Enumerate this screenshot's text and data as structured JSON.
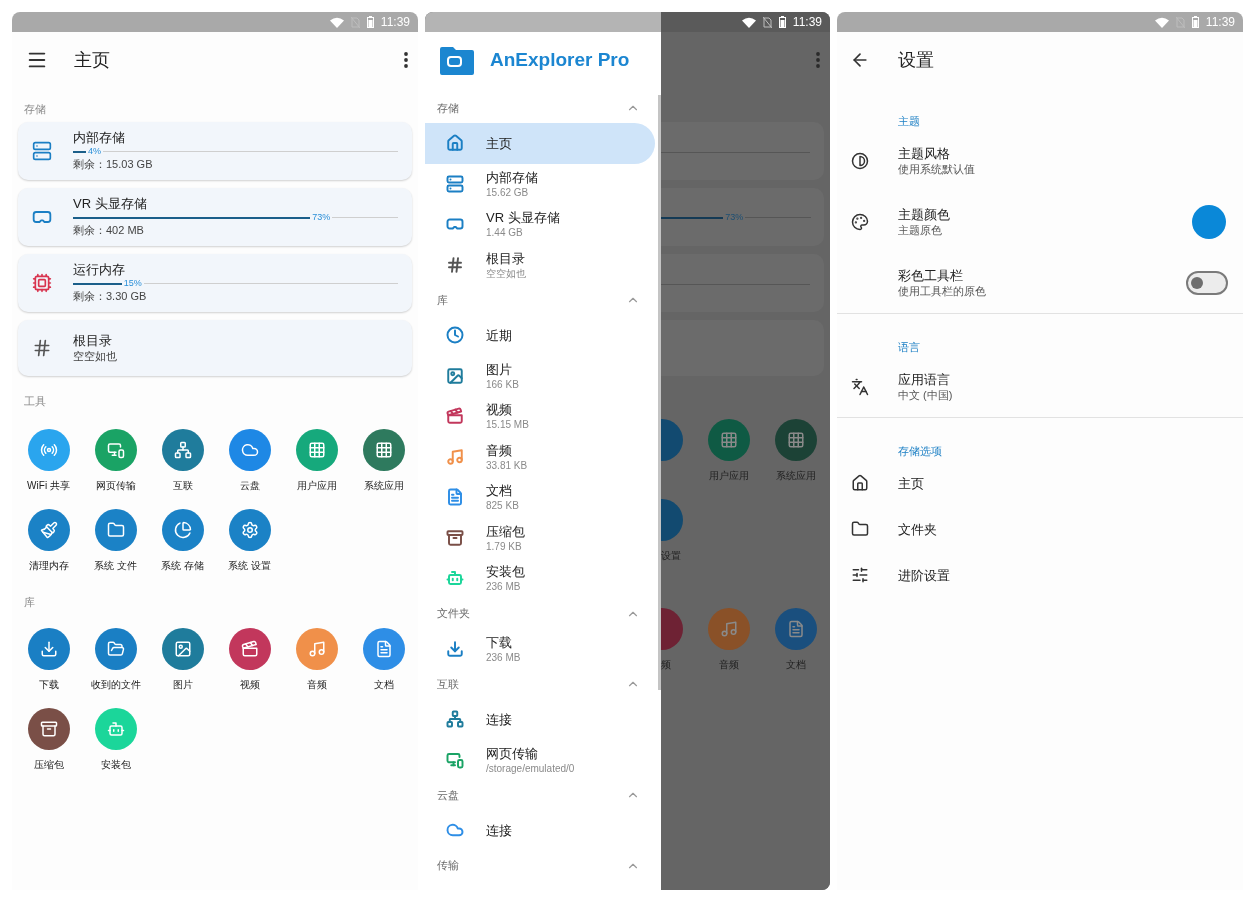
{
  "home": {
    "time": "11:39",
    "title": "主页",
    "storage_title": "存储",
    "storage": [
      {
        "kind": "meter",
        "name": "内部存储",
        "level": 0.04,
        "reading": "4%",
        "subtitle": "剩余：15.03 GB",
        "color": "#1b7fc4"
      },
      {
        "kind": "meter",
        "name": "VR 头显存储",
        "level": 0.73,
        "reading": "73%",
        "subtitle": "剩余：402 MB",
        "color": "#1b7fc4"
      },
      {
        "kind": "meter",
        "name": "运行内存",
        "level": 0.15,
        "reading": "15%",
        "subtitle": "剩余：3.30 GB",
        "color": "#d8344f"
      },
      {
        "kind": "plain",
        "name": "根目录",
        "subtitle": "空空如也",
        "color": "#555555"
      }
    ],
    "tools_title": "工具",
    "tools": [
      {
        "label": "WiFi 共享",
        "color": "#2aa5ee"
      },
      {
        "label": "网页传输",
        "color": "#1aa365"
      },
      {
        "label": "互联",
        "color": "#1f7c9c"
      },
      {
        "label": "云盘",
        "color": "#1e88e5"
      },
      {
        "label": "用户应用",
        "color": "#16a97c"
      },
      {
        "label": "系统应用",
        "color": "#2e7a5e"
      },
      {
        "label": "清理内存",
        "color": "#1b82c6"
      },
      {
        "label": "系统 文件",
        "color": "#1b82c6"
      },
      {
        "label": "系统 存储",
        "color": "#1b82c6"
      },
      {
        "label": "系统 设置",
        "color": "#1b82c6"
      }
    ],
    "library_title": "库",
    "library": [
      {
        "label": "下载",
        "color": "#1a7fc4"
      },
      {
        "label": "收到的文件",
        "color": "#1a7fc4"
      },
      {
        "label": "图片",
        "color": "#1f7c9c"
      },
      {
        "label": "视频",
        "color": "#c2375c"
      },
      {
        "label": "音频",
        "color": "#f0904a"
      },
      {
        "label": "文档",
        "color": "#2e8ee6"
      },
      {
        "label": "压缩包",
        "color": "#7a4f47"
      },
      {
        "label": "安装包",
        "color": "#1bd69a"
      }
    ]
  },
  "drawer": {
    "time": "11:39",
    "app_name": "AnExplorer Pro",
    "sections": [
      {
        "title": "存储",
        "expanded": true,
        "items": [
          {
            "label": "主页",
            "selected": true,
            "color": "#1b7fc4"
          },
          {
            "label": "内部存储",
            "subtitle": "15.62 GB",
            "selected": false,
            "color": "#1b7fc4"
          },
          {
            "label": "VR 头显存储",
            "subtitle": "1.44 GB",
            "selected": false,
            "color": "#1b7fc4"
          },
          {
            "label": "根目录",
            "subtitle": "空空如也",
            "selected": false,
            "color": "#555555"
          }
        ]
      },
      {
        "title": "库",
        "expanded": true,
        "items": [
          {
            "label": "近期",
            "selected": false,
            "color": "#1b7fc4"
          },
          {
            "label": "图片",
            "subtitle": "166 KB",
            "selected": false,
            "color": "#1f7c9c"
          },
          {
            "label": "视频",
            "subtitle": "15.15 MB",
            "selected": false,
            "color": "#c2375c"
          },
          {
            "label": "音频",
            "subtitle": "33.81 KB",
            "selected": false,
            "color": "#f0904a"
          },
          {
            "label": "文档",
            "subtitle": "825 KB",
            "selected": false,
            "color": "#2e8ee6"
          },
          {
            "label": "压缩包",
            "subtitle": "1.79 KB",
            "selected": false,
            "color": "#7a4f47"
          },
          {
            "label": "安装包",
            "subtitle": "236 MB",
            "selected": false,
            "color": "#1bd69a"
          }
        ]
      },
      {
        "title": "文件夹",
        "expanded": true,
        "items": [
          {
            "label": "下载",
            "subtitle": "236 MB",
            "selected": false,
            "color": "#1b7fc4"
          }
        ]
      },
      {
        "title": "互联",
        "expanded": true,
        "items": [
          {
            "label": "连接",
            "selected": false,
            "color": "#1f7c9c"
          },
          {
            "label": "网页传输",
            "subtitle": "/storage/emulated/0",
            "selected": false,
            "color": "#1aa365"
          }
        ]
      },
      {
        "title": "云盘",
        "expanded": true,
        "items": [
          {
            "label": "连接",
            "selected": false,
            "color": "#2e8ee6"
          }
        ]
      },
      {
        "title": "传输",
        "expanded": true
      }
    ]
  },
  "behind_drawer": {
    "meter": {
      "level": 0.73,
      "reading": "73%"
    },
    "rows": [
      [
        {
          "kind": "cut",
          "color": "#124a70"
        },
        {
          "kind": "full",
          "label": "用户应用",
          "color": "#0f5a44"
        },
        {
          "kind": "full",
          "label": "系统应用",
          "color": "#1c4236"
        }
      ],
      [
        {
          "kind": "cut",
          "label": "设置",
          "color": "#124a70"
        }
      ],
      [
        {
          "kind": "cut",
          "label": "频",
          "color": "#6e2234"
        },
        {
          "kind": "full",
          "label": "音频",
          "color": "#8a5128"
        },
        {
          "kind": "full",
          "label": "文档",
          "color": "#1a4f7e"
        }
      ]
    ]
  },
  "settings": {
    "time": "11:39",
    "title": "设置",
    "groups": [
      {
        "title": "主题",
        "items": [
          {
            "kind": "text",
            "title": "主题风格",
            "subtitle": "使用系统默认值"
          },
          {
            "kind": "color",
            "title": "主题颜色",
            "subtitle": "主题原色",
            "color": "#0a88d8"
          },
          {
            "kind": "switch",
            "title": "彩色工具栏",
            "subtitle": "使用工具栏的原色",
            "on": false
          }
        ]
      },
      {
        "title": "语言",
        "items": [
          {
            "kind": "text",
            "title": "应用语言",
            "subtitle": "中文 (中国)"
          }
        ]
      },
      {
        "title": "存储选项",
        "items": [
          {
            "kind": "text",
            "title": "主页"
          },
          {
            "kind": "text",
            "title": "文件夹"
          },
          {
            "kind": "text",
            "title": "进阶设置"
          }
        ]
      }
    ]
  }
}
